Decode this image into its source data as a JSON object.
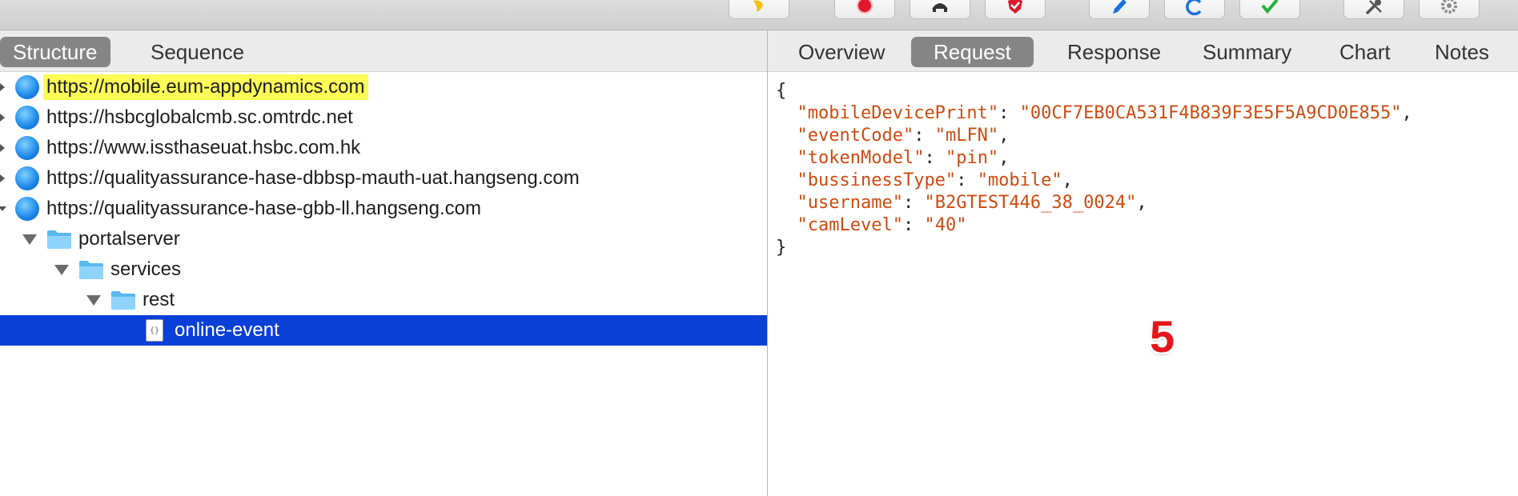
{
  "toolbar": {
    "buttons": [
      {
        "icon": "brush-icon",
        "color": "#f3c200"
      },
      {
        "icon": "record-icon",
        "color": "#e0182b"
      },
      {
        "icon": "turtle-icon",
        "color": "#333333"
      },
      {
        "icon": "shield-breakpoint-icon",
        "color": "#e0182b"
      },
      {
        "icon": "pen-compose-icon",
        "color": "#1a6fe0"
      },
      {
        "icon": "refresh-icon",
        "color": "#1a6fe0"
      },
      {
        "icon": "checkmark-icon",
        "color": "#23b23a"
      },
      {
        "icon": "tools-icon",
        "color": "#555555"
      },
      {
        "icon": "gear-icon",
        "color": "#8a8a8a"
      }
    ]
  },
  "left": {
    "tabs": [
      {
        "label": "Structure",
        "active": true
      },
      {
        "label": "Sequence",
        "active": false
      }
    ],
    "tree": [
      {
        "label": "https://mobile.eum-appdynamics.com",
        "type": "host",
        "highlighted": true
      },
      {
        "label": "https://hsbcglobalcmb.sc.omtrdc.net",
        "type": "host"
      },
      {
        "label": "https://www.issthaseuat.hsbc.com.hk",
        "type": "host"
      },
      {
        "label": "https://qualityassurance-hase-dbbsp-mauth-uat.hangseng.com",
        "type": "host"
      },
      {
        "label": "https://qualityassurance-hase-gbb-ll.hangseng.com",
        "type": "host",
        "expanded": true
      },
      {
        "label": "portalserver",
        "type": "folder"
      },
      {
        "label": "services",
        "type": "folder"
      },
      {
        "label": "rest",
        "type": "folder"
      },
      {
        "label": "online-event",
        "type": "file",
        "selected": true
      }
    ]
  },
  "right": {
    "tabs": [
      {
        "label": "Overview",
        "active": false
      },
      {
        "label": "Request",
        "active": true
      },
      {
        "label": "Response",
        "active": false
      },
      {
        "label": "Summary",
        "active": false
      },
      {
        "label": "Chart",
        "active": false
      },
      {
        "label": "Notes",
        "active": false
      }
    ],
    "json_open": "{",
    "json_close": "}",
    "json_lines": [
      {
        "key": "\"mobileDevicePrint\"",
        "value": "\"00CF7EB0CA531F4B839F3E5F5A9CD0E855\"",
        "comma": ","
      },
      {
        "key": "\"eventCode\"",
        "value": "\"mLFN\"",
        "comma": ","
      },
      {
        "key": "\"tokenModel\"",
        "value": "\"pin\"",
        "comma": ","
      },
      {
        "key": "\"bussinessType\"",
        "value": "\"mobile\"",
        "comma": ","
      },
      {
        "key": "\"username\"",
        "value": "\"B2GTEST446_38_0024\"",
        "comma": ","
      },
      {
        "key": "\"camLevel\"",
        "value": "\"40\"",
        "comma": ""
      }
    ]
  },
  "overlay": {
    "step_number": "5",
    "color": "#e3171d"
  },
  "colors": {
    "selection": "#0a3fd8",
    "highlight": "#fdfb55",
    "json_string": "#cf4a10",
    "active_tab": "#858585"
  }
}
